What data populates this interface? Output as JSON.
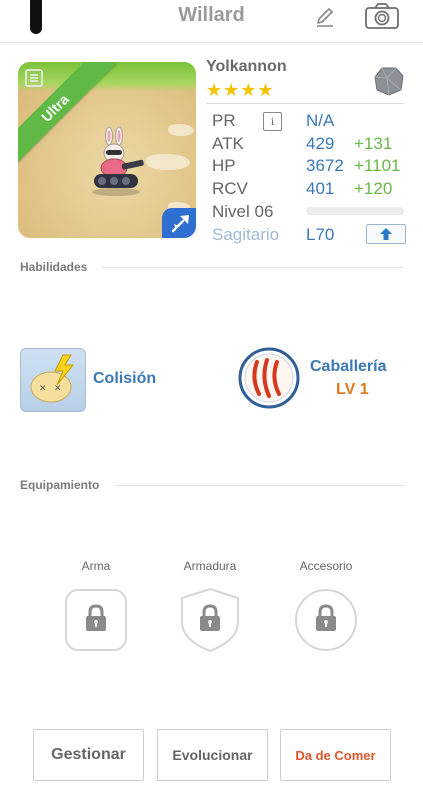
{
  "header": {
    "title": "Willard",
    "edit_icon": "pencil-icon",
    "camera_icon": "camera-icon"
  },
  "monster": {
    "rarity_ribbon": "Ultra",
    "name": "Yolkannon",
    "stars": "★★★★",
    "element_icon": "stone-element-icon",
    "type_icon": "flying-type-icon"
  },
  "stats": {
    "pr": {
      "label": "PR",
      "value": "N/A"
    },
    "atk": {
      "label": "ATK",
      "value": "429",
      "bonus": "+131"
    },
    "hp": {
      "label": "HP",
      "value": "3672",
      "bonus": "+1101"
    },
    "rcv": {
      "label": "RCV",
      "value": "401",
      "bonus": "+120"
    },
    "level": {
      "label": "Nivel 06",
      "progress": 0.0
    },
    "sign": {
      "label": "Sagitario",
      "value": "L70"
    }
  },
  "sections": {
    "skills_title": "Habilidades",
    "equipment_title": "Equipamiento"
  },
  "skills": [
    {
      "name": "Colisión"
    },
    {
      "name": "Caballería",
      "level": "LV 1"
    }
  ],
  "equipment": [
    {
      "label": "Arma"
    },
    {
      "label": "Armadura"
    },
    {
      "label": "Accesorio"
    }
  ],
  "buttons": {
    "manage": "Gestionar",
    "evolve": "Evolucionar",
    "feed": "Da de Comer"
  },
  "colors": {
    "accent_blue": "#3a78b6",
    "bonus_green": "#6ab84a",
    "level_orange": "#e07a1f",
    "feed_red": "#e0562b",
    "star_yellow": "#f4c400"
  }
}
